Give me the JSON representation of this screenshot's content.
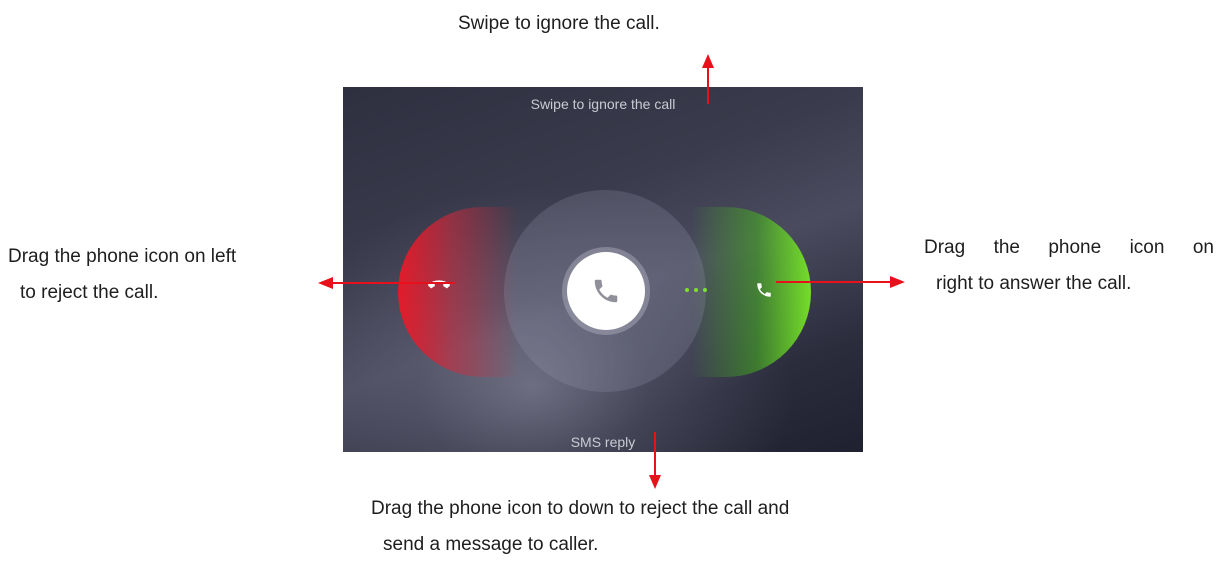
{
  "annotations": {
    "top": "Swipe to ignore the call.",
    "left_line1": "Drag the phone icon on left",
    "left_line2": "to reject the call.",
    "right_line1_words": [
      "Drag",
      "the",
      "phone",
      "icon",
      "on"
    ],
    "right_line2": "right to answer the call.",
    "bottom_line1": "Drag the phone icon to down to reject the call and",
    "bottom_line2": "send a message to caller."
  },
  "screen": {
    "swipe_label": "Swipe to ignore the call",
    "sms_label": "SMS reply"
  },
  "icons": {
    "center": "phone-icon",
    "left": "phone-hangup-icon",
    "right": "phone-icon",
    "dots": "ellipsis-icon"
  },
  "colors": {
    "arrow": "#e8101a",
    "reject": "#e8192a",
    "answer": "#7de02c"
  }
}
